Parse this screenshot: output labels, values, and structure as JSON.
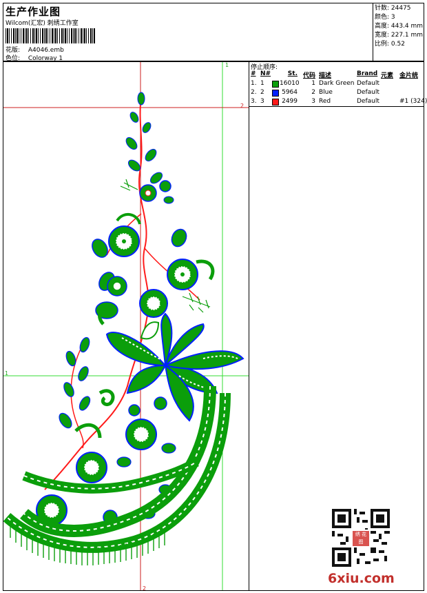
{
  "header": {
    "title": "生产作业图",
    "subtitle": "Wilcom(汇宏) 刺绣工作室",
    "design_label": "花版:",
    "design_value": "A4046.emb",
    "colorway_label": "色位:",
    "colorway_value": "Colorway 1"
  },
  "stats": {
    "stitches": "针数: 24475",
    "colors": "颜色: 3",
    "height": "高度: 443.4 mm",
    "width": "宽度: 227.1 mm",
    "scale": "比例: 0.52"
  },
  "guides": {
    "v1_label": "1",
    "v2_label": "2",
    "h1_label": "1",
    "h2_label": "2"
  },
  "stop_sequence": {
    "title": "停止顺序:",
    "headers": {
      "no": "#",
      "n": "N#",
      "st": "St.",
      "code": "代码",
      "desc": "描述",
      "brand": "Brand",
      "elem": "元素",
      "seq": "金片统"
    },
    "rows": [
      {
        "no": "1.",
        "n": "1",
        "color": "#0b9e0b",
        "st": "16010",
        "code": "1",
        "desc": "Dark Green",
        "brand": "Default",
        "seq": ""
      },
      {
        "no": "2.",
        "n": "2",
        "color": "#0020ff",
        "st": "5964",
        "code": "2",
        "desc": "Blue",
        "brand": "Default",
        "seq": ""
      },
      {
        "no": "3.",
        "n": "3",
        "color": "#ff1a1a",
        "st": "2499",
        "code": "3",
        "desc": "Red",
        "brand": "Default",
        "seq": "#1 (324)"
      }
    ]
  },
  "qr": {
    "stamp": "绣 花 图"
  },
  "watermark": "6xiu.com",
  "colors": {
    "green": "#0b9e0b",
    "blue": "#0020ff",
    "red": "#ff1a1a",
    "guide_green": "#33dd33",
    "guide_red": "#cc1f1f"
  }
}
